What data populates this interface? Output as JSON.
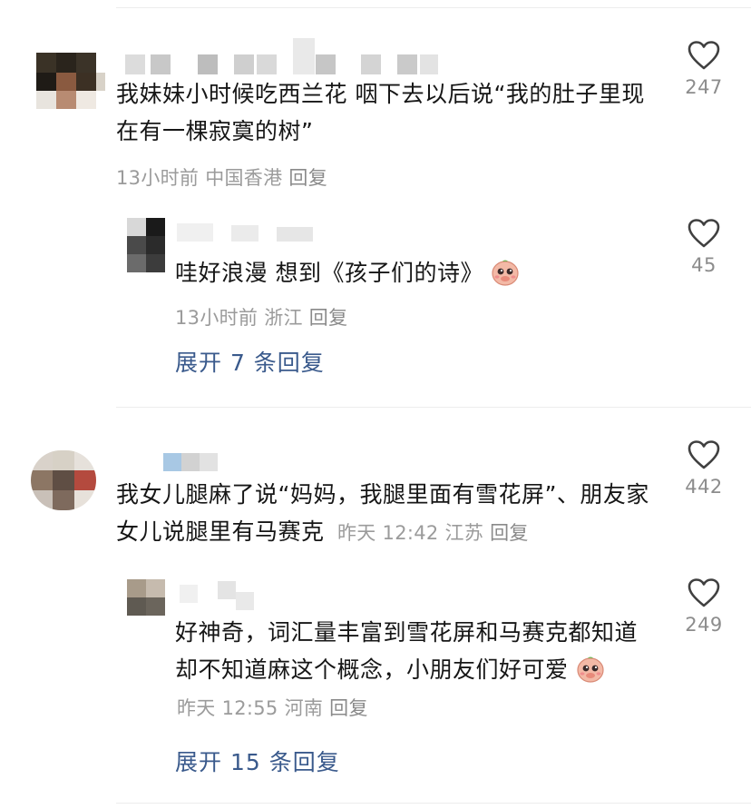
{
  "comments": [
    {
      "text": "我妹妹小时候吃西兰花 咽下去以后说“我的肚子里现在有一棵寂寞的树”",
      "meta": "13小时前 中国香港",
      "reply_label": "回复",
      "likes": "247",
      "reply": {
        "text": "哇好浪漫 想到《孩子们的诗》",
        "meta": "13小时前 浙江",
        "reply_label": "回复",
        "likes": "45"
      },
      "expand": "展开 7 条回复"
    },
    {
      "text": "我女儿腿麻了说“妈妈，我腿里面有雪花屏”、朋友家女儿说腿里有马赛克",
      "meta": "昨天 12:42 江苏",
      "reply_label": "回复",
      "likes": "442",
      "reply": {
        "text": "好神奇，词汇量丰富到雪花屏和马赛克都知道却不知道麻这个概念，小朋友们好可爱",
        "meta": "昨天 12:55 河南",
        "reply_label": "回复",
        "likes": "249"
      },
      "expand": "展开 15 条回复"
    }
  ],
  "icons": {
    "like": "heart-outline-icon",
    "emoji": "pleading-face-emoji"
  },
  "colors": {
    "expand_link": "#3a5a8c",
    "meta": "#9b9b9b",
    "text": "#161616"
  }
}
